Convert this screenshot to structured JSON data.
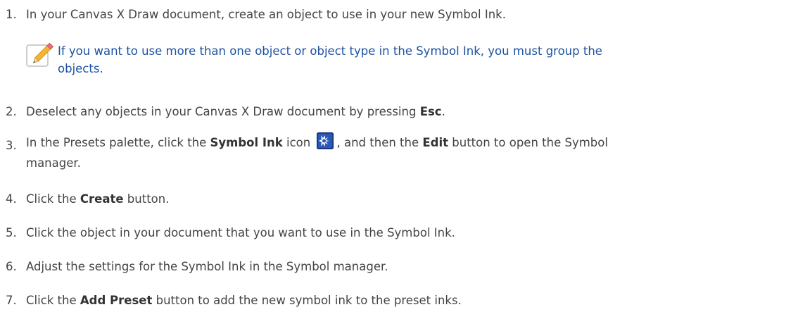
{
  "steps": [
    {
      "number": "1.",
      "text_before": "In your Canvas X Draw document, create an object to use in your new Symbol Ink."
    },
    {
      "number": "2.",
      "text_before": "Deselect any objects in your Canvas X Draw document by pressing ",
      "bold": "Esc",
      "text_after": "."
    },
    {
      "number": "3.",
      "part1": "In the Presets palette, click the ",
      "bold1": "Symbol Ink",
      "part2": " icon ",
      "part3": ", and then the ",
      "bold2": "Edit",
      "part4": " button to open the Symbol",
      "line2": "manager."
    },
    {
      "number": "4.",
      "text_before": "Click the ",
      "bold": "Create",
      "text_after": " button."
    },
    {
      "number": "5.",
      "text_before": "Click the object in your document that you want to use in the Symbol Ink."
    },
    {
      "number": "6.",
      "text_before": "Adjust the settings for the Symbol Ink in the Symbol manager."
    },
    {
      "number": "7.",
      "text_before": "Click the ",
      "bold": "Add Preset",
      "text_after": " button to add the new symbol ink to the preset inks."
    }
  ],
  "note": {
    "line1": "If you want to use more than one object or object type in the Symbol Ink, you must group the",
    "line2": "objects.",
    "icon": "pencil-note-icon",
    "color": "#1d52a1"
  },
  "icons": {
    "symbol_ink": "symbol-ink-icon"
  }
}
